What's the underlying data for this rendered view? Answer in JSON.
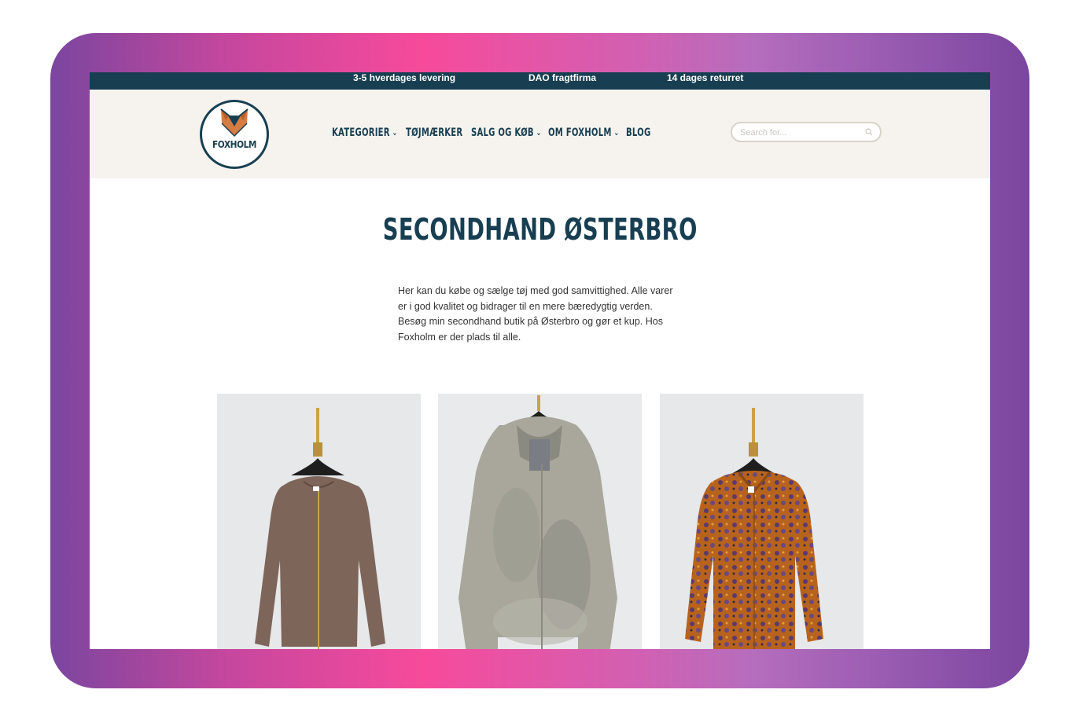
{
  "topbar": {
    "items": [
      "3-5 hverdages levering",
      "DAO fragtfirma",
      "14 dages returret"
    ],
    "color": "#183f51"
  },
  "logo": {
    "text": "FOXHOLM",
    "icon": "fox-logo-icon"
  },
  "nav": {
    "items": [
      {
        "label": "KATEGORIER",
        "dropdown": true
      },
      {
        "label": "TØJMÆRKER",
        "dropdown": false
      },
      {
        "label": "SALG OG KØB",
        "dropdown": true
      },
      {
        "label": "OM FOXHOLM",
        "dropdown": true
      },
      {
        "label": "BLOG",
        "dropdown": false
      }
    ],
    "chevron_icon": "chevron-down-icon"
  },
  "search": {
    "placeholder": "Search for...",
    "value": "",
    "icon": "search-icon"
  },
  "page": {
    "title": "SECONDHAND ØSTERBRO",
    "intro": "Her kan du købe og sælge tøj med god samvittighed. Alle varer er i god kvalitet og bidrager til en mere bæredygtig verden. Besøg min secondhand butik på Østerbro og gør et kup. Hos Foxholm er der plads til alle."
  },
  "products": [
    {
      "name": "brown-zip-cardigan-image",
      "color": "#7d655a"
    },
    {
      "name": "grey-fur-coat-image",
      "color": "#a9a79b"
    },
    {
      "name": "orange-paisley-shirt-image",
      "color": "#b8631d"
    }
  ],
  "colors": {
    "brand_dark": "#183f51",
    "brand_orange": "#d57c43",
    "header_bg": "#f6f3ef"
  }
}
